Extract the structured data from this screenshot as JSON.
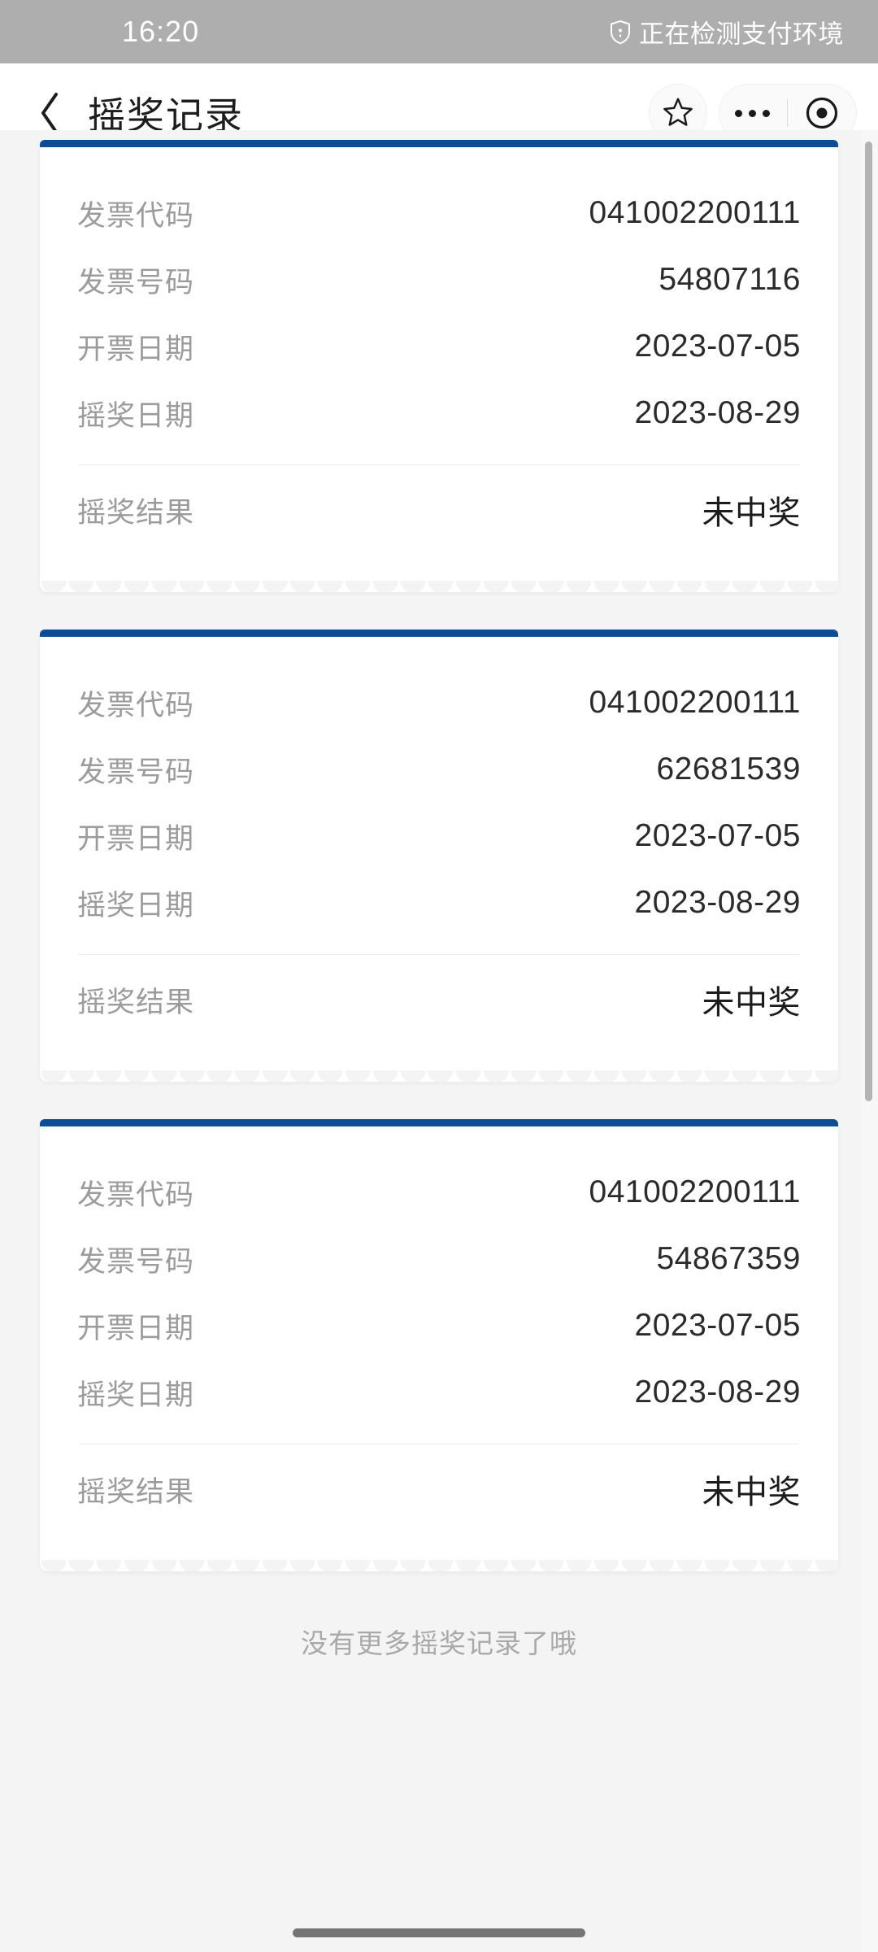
{
  "status_bar": {
    "time": "16:20",
    "security_icon": "shield-icon",
    "security_text": "正在检测支付环境",
    "background_color": "#aeaeae",
    "text_color": "#ffffff"
  },
  "nav_bar": {
    "back_icon": "chevron-left-icon",
    "title": "摇奖记录",
    "favorite_icon": "star-icon",
    "menu_icon": "more-dots-icon",
    "target_icon": "target-circle-icon",
    "background_color": "#ffffff"
  },
  "theme": {
    "accent_color": "#0d4d93",
    "page_background": "#f4f4f4",
    "card_background": "#ffffff",
    "label_color": "#9b9b9b",
    "value_color": "#2b2b2b"
  },
  "labels": {
    "invoice_code": "发票代码",
    "invoice_number": "发票号码",
    "invoice_date": "开票日期",
    "draw_date": "摇奖日期",
    "draw_result": "摇奖结果"
  },
  "records": [
    {
      "invoice_code": "041002200111",
      "invoice_number": "54807116",
      "invoice_date": "2023-07-05",
      "draw_date": "2023-08-29",
      "draw_result": "未中奖"
    },
    {
      "invoice_code": "041002200111",
      "invoice_number": "62681539",
      "invoice_date": "2023-07-05",
      "draw_date": "2023-08-29",
      "draw_result": "未中奖"
    },
    {
      "invoice_code": "041002200111",
      "invoice_number": "54867359",
      "invoice_date": "2023-07-05",
      "draw_date": "2023-08-29",
      "draw_result": "未中奖"
    }
  ],
  "list_footer": "没有更多摇奖记录了哦"
}
